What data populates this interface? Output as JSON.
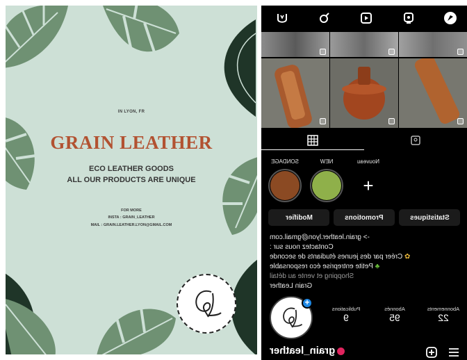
{
  "poster": {
    "location": "IN LYON, FR",
    "brand": "GRAIN LEATHER",
    "tagline_1": "ECO LEATHER GOODS",
    "tagline_2": "ALL OUR PRODUCTS ARE UNIQUE",
    "for_more": "FOR MORE",
    "insta": "INSTA : GRAIN_LEATHER",
    "mail": "MAIL : GRAIN.LEATHER.LYON@GMAIL.COM",
    "colors": {
      "background": "#cde0d6",
      "brand": "#b25231",
      "leaf": "#6f9173"
    }
  },
  "profile": {
    "top_icons": [
      "tabs-logo-icon",
      "female-symbol-icon",
      "play-icon",
      "face-icon",
      "compass-icon"
    ],
    "tabs": [
      "grid-icon",
      "tagged-icon"
    ],
    "highlights": [
      {
        "label": "SONDAGE",
        "color": "#8b4a23"
      },
      {
        "label": "NEW",
        "color": "#8fb04a"
      },
      {
        "label": "Nouveau",
        "plus": "+"
      }
    ],
    "buttons": [
      "Modifier",
      "Promotions",
      "Statistiques"
    ],
    "bio": {
      "line1": "-> grain.leather.lyon@gmail.com",
      "line2": "Contactez nous sur :",
      "line3": "Créer par des jeunes étudiants de seconde",
      "line4": "Petite entreprise éco responsable",
      "line5": "Shopping et vente au détail",
      "line6": "Grain Leather"
    },
    "stats": [
      {
        "value": "9",
        "label": "Publications"
      },
      {
        "value": "95",
        "label": "Abonnés"
      },
      {
        "value": "22",
        "label": "Abonnements"
      }
    ],
    "username": "grain_leather",
    "avatar_badge": "+"
  }
}
